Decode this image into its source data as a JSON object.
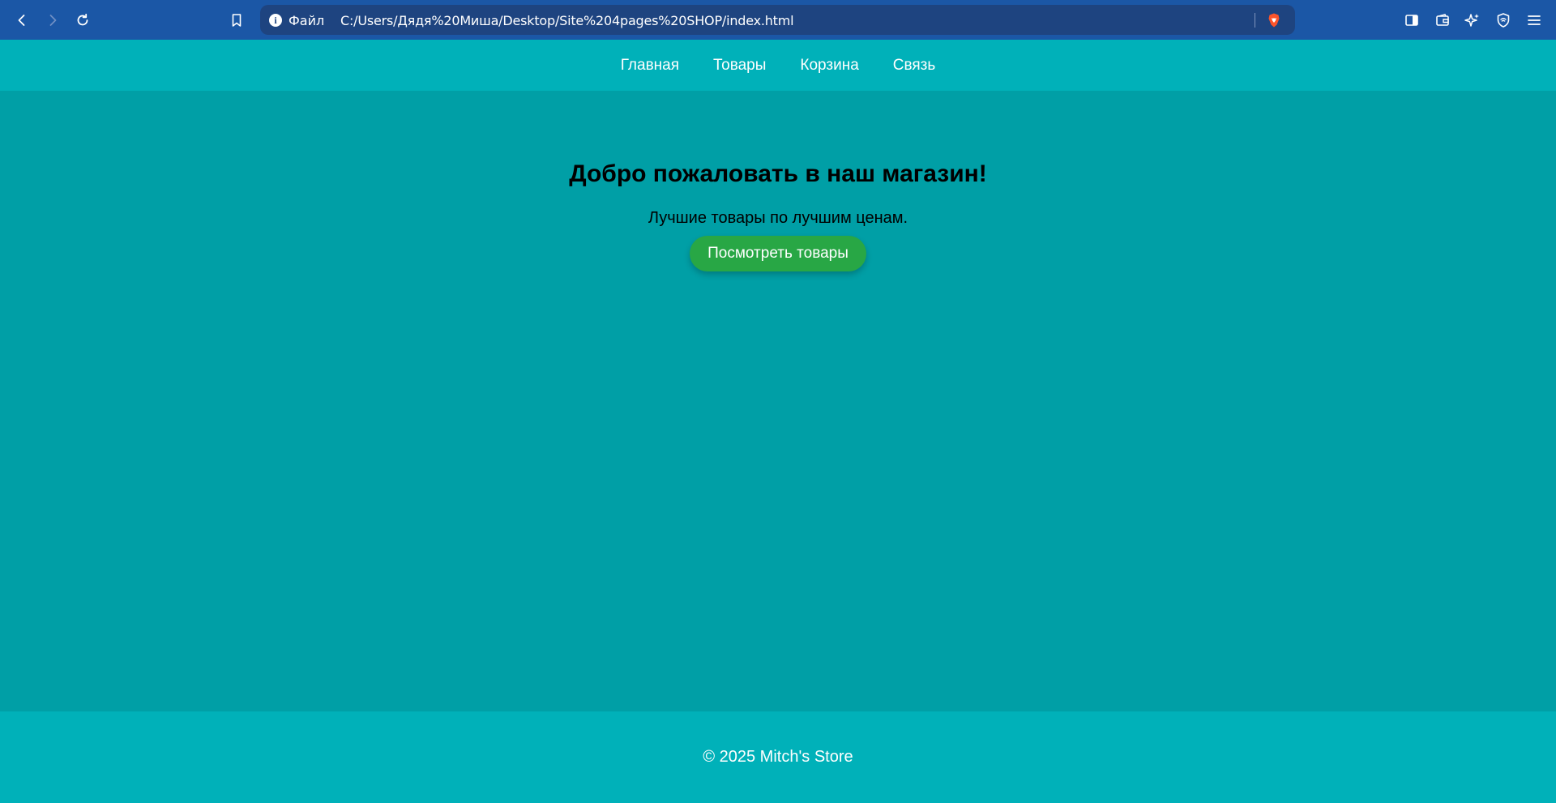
{
  "browser": {
    "url_scheme": "Файл",
    "url": "C:/Users/Дядя%20Миша/Desktop/Site%204pages%20SHOP/index.html",
    "toolbar_icons": [
      "back-icon",
      "forward-icon",
      "reload-icon",
      "bookmark-icon",
      "site-info-icon",
      "brave-shields-icon",
      "sidebar-icon",
      "wallet-icon",
      "leo-ai-icon",
      "vpn-icon",
      "menu-icon"
    ],
    "colors": {
      "toolbar": "#1b57a6",
      "urlbar": "#1e4480"
    }
  },
  "nav": {
    "items": [
      {
        "label": "Главная"
      },
      {
        "label": "Товары"
      },
      {
        "label": "Корзина"
      },
      {
        "label": "Связь"
      }
    ]
  },
  "hero": {
    "title": "Добро пожаловать в наш магазин!",
    "subtitle": "Лучшие товары по лучшим ценам.",
    "button_label": "Посмотреть товары"
  },
  "footer": {
    "text": "© 2025 Mitch's Store"
  },
  "colors": {
    "nav_footer_bg": "#00b1b9",
    "page_bg": "#009fa6",
    "button": "#28a745"
  }
}
